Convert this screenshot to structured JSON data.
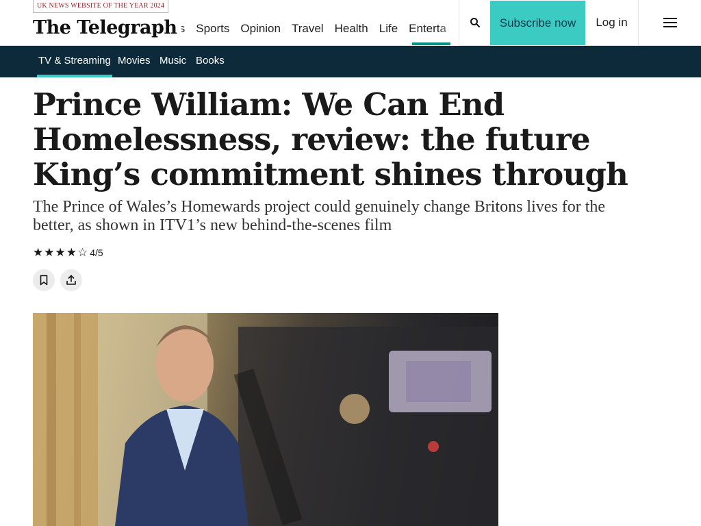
{
  "header": {
    "award": "UK NEWS WEBSITE OF THE YEAR 2024",
    "logo": "The Telegraph",
    "nav": [
      "vals",
      "Sports",
      "Opinion",
      "Travel",
      "Health",
      "Life",
      "Enterta"
    ],
    "active_nav": "Enterta",
    "subscribe_label": "Subscribe now",
    "login_label": "Log in",
    "search_icon": "search-icon",
    "menu_icon": "hamburger-menu-icon"
  },
  "subnav": {
    "items": [
      "TV & Streaming",
      "Movies",
      "Music",
      "Books"
    ],
    "active": "TV & Streaming"
  },
  "article": {
    "headline": "Prince William: We Can End Homelessness, review: the future King’s commitment shines through",
    "standfirst": "The Prince of Wales’s Homewards project could genuinely change Britons lives for the better, as shown in ITV1’s new behind-the-scenes film",
    "rating": {
      "value": 4,
      "max": 5,
      "label": "4/5"
    },
    "actions": [
      "bookmark-icon",
      "share-icon"
    ]
  },
  "colors": {
    "accent": "#3ccbc3",
    "subnav_bg": "#0d2a3a",
    "award_text": "#8b1f1f"
  }
}
